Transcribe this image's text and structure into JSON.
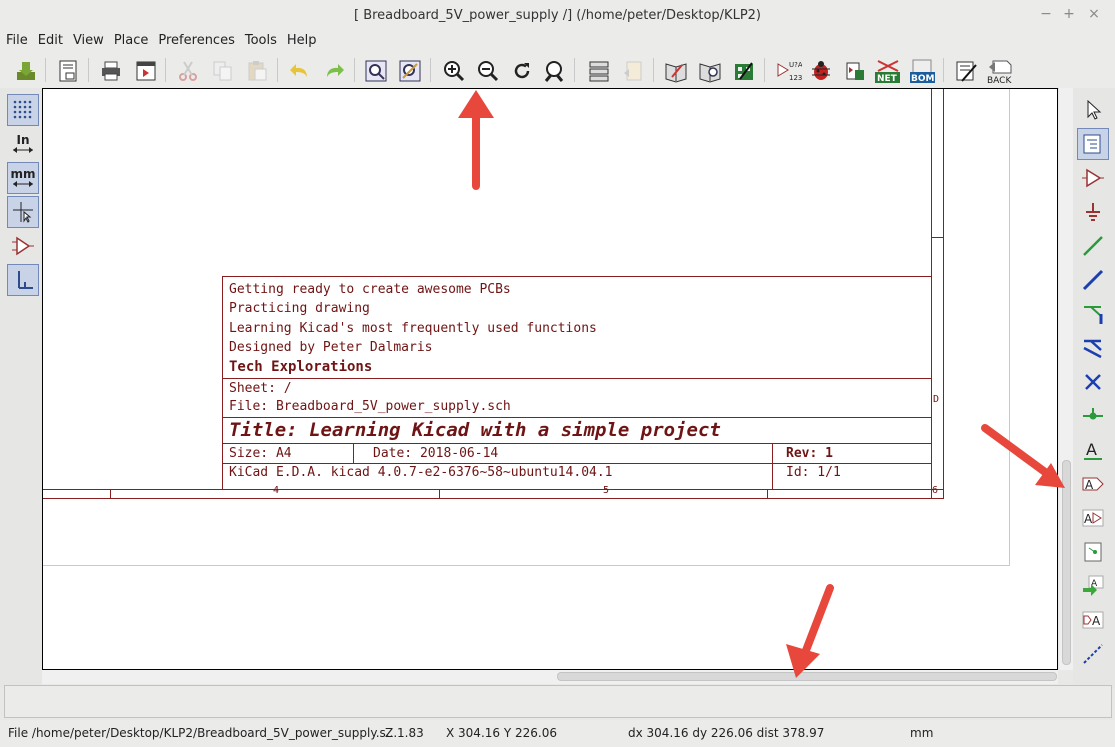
{
  "window": {
    "title": "[ Breadboard_5V_power_supply /] (/home/peter/Desktop/KLP2)",
    "controls": [
      "−",
      "+",
      "×"
    ]
  },
  "menu": [
    "File",
    "Edit",
    "View",
    "Place",
    "Preferences",
    "Tools",
    "Help"
  ],
  "toolbar": {
    "items": [
      "save-icon",
      "page-settings-icon",
      "print-icon",
      "plot-icon",
      "cut-icon",
      "copy-icon",
      "paste-icon",
      "undo-icon",
      "redo-icon",
      "find-icon",
      "find-replace-icon",
      "zoom-in-icon",
      "zoom-out-icon",
      "redraw-icon",
      "zoom-fit-icon",
      "hierarchy-navigator-icon",
      "leave-sheet-icon",
      "library-editor-icon",
      "library-browser-icon",
      "footprint-editor-icon",
      "annotate-icon",
      "erc-icon",
      "cvpcb-icon",
      "netlist-icon",
      "bom-icon",
      "pcbnew-icon",
      "back-import-icon"
    ],
    "annotate_label": "U?A",
    "annotate_sub": "123",
    "netlist_label": "NET",
    "bom_label": "BOM",
    "back_label": "BACK"
  },
  "left_toolbar": {
    "inch_label": "In",
    "mm_label": "mm"
  },
  "title_block": {
    "comment1": "Getting ready to create awesome PCBs",
    "comment2": "Practicing drawing",
    "comment3": "Learning Kicad's most frequently used functions",
    "comment4": "Designed by Peter Dalmaris",
    "company": "Tech Explorations",
    "sheet": "Sheet: /",
    "file": "File: Breadboard_5V_power_supply.sch",
    "title": "Title: Learning Kicad with a simple project",
    "size": "Size: A4",
    "date": "Date: 2018-06-14",
    "rev": "Rev: 1",
    "kicad": "KiCad E.D.A.  kicad 4.0.7-e2-6376~58~ubuntu14.04.1",
    "id": "Id: 1/1"
  },
  "frame": {
    "col_labels": [
      "4",
      "5",
      "6"
    ],
    "row_label": "D"
  },
  "status": {
    "file": "File /home/peter/Desktop/KLP2/Breadboard_5V_power_supply.s...",
    "zoom": "Z 1.83",
    "xy": "X 304.16  Y 226.06",
    "delta": "dx 304.16  dy 226.06  dist 378.97",
    "units": "mm"
  },
  "colors": {
    "title_block": "#6f1414",
    "arrow": "#e8473c",
    "active_tool": "#c8d3e8"
  }
}
